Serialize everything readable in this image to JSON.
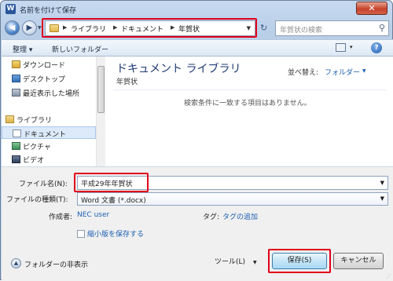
{
  "window": {
    "title": "名前を付けて保存",
    "app_icon": "W",
    "close_glyph": "✕"
  },
  "nav": {
    "back_glyph": "◀",
    "forward_glyph": "▶",
    "dropdown_glyph": "▼"
  },
  "address": {
    "crumbs": [
      "ライブラリ",
      "ドキュメント",
      "年賀状"
    ],
    "separator": "▶",
    "dropdown_glyph": "▼",
    "refresh_glyph": "↻"
  },
  "search": {
    "placeholder": "年賀状の検索",
    "icon": "search-icon",
    "icon_glyph": "⚲"
  },
  "toolbar": {
    "organize": "整理 ▾",
    "new_folder": "新しいフォルダー",
    "view_drop_glyph": "▾",
    "help_glyph": "?"
  },
  "navpane": {
    "items": [
      {
        "label": "ダウンロード",
        "icon": "download-folder-icon"
      },
      {
        "label": "デスクトップ",
        "icon": "desktop-icon"
      },
      {
        "label": "最近表示した場所",
        "icon": "recent-places-icon"
      },
      {
        "label": "ライブラリ",
        "icon": "library-icon"
      },
      {
        "label": "ドキュメント",
        "icon": "documents-icon"
      },
      {
        "label": "ピクチャ",
        "icon": "pictures-icon"
      },
      {
        "label": "ビデオ",
        "icon": "videos-icon"
      }
    ],
    "selected": "ドキュメント"
  },
  "content": {
    "library_title": "ドキュメント ライブラリ",
    "library_subtitle": "年賀状",
    "sort_label": "並べ替え:",
    "sort_value": "フォルダー",
    "sort_drop_glyph": "▼",
    "empty_message": "検索条件に一致する項目はありません。"
  },
  "form": {
    "filename_label": "ファイル名(N):",
    "filename_value": "平成29年年賀状",
    "filetype_label": "ファイルの種類(T):",
    "filetype_value": "Word 文書 (*.docx)",
    "dropdown_glyph": "▼",
    "author_label": "作成者:",
    "author_value": "NEC user",
    "tags_label": "タグ:",
    "tags_value": "タグの追加",
    "thumbnail_label": "縮小版を保存する",
    "hide_folders_glyph": "▲",
    "hide_folders_label": "フォルダーの非表示",
    "tools_label": "ツール(L)",
    "tools_drop_glyph": "▼",
    "save_label": "保存(S)",
    "cancel_label": "キャンセル",
    "grip_glyph": "⋰"
  },
  "colors": {
    "highlight_red": "#e0001a",
    "link_blue": "#1b5fb3",
    "title_blue": "#1e3a73"
  }
}
